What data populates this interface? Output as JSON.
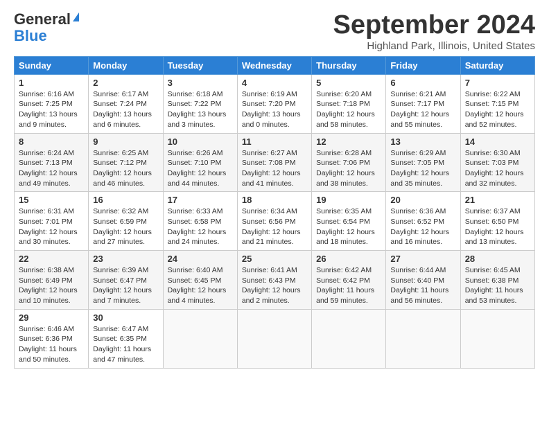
{
  "header": {
    "logo_general": "General",
    "logo_blue": "Blue",
    "month_title": "September 2024",
    "location": "Highland Park, Illinois, United States"
  },
  "weekdays": [
    "Sunday",
    "Monday",
    "Tuesday",
    "Wednesday",
    "Thursday",
    "Friday",
    "Saturday"
  ],
  "weeks": [
    [
      {
        "day": "1",
        "sunrise": "6:16 AM",
        "sunset": "7:25 PM",
        "daylight": "13 hours and 9 minutes."
      },
      {
        "day": "2",
        "sunrise": "6:17 AM",
        "sunset": "7:24 PM",
        "daylight": "13 hours and 6 minutes."
      },
      {
        "day": "3",
        "sunrise": "6:18 AM",
        "sunset": "7:22 PM",
        "daylight": "13 hours and 3 minutes."
      },
      {
        "day": "4",
        "sunrise": "6:19 AM",
        "sunset": "7:20 PM",
        "daylight": "13 hours and 0 minutes."
      },
      {
        "day": "5",
        "sunrise": "6:20 AM",
        "sunset": "7:18 PM",
        "daylight": "12 hours and 58 minutes."
      },
      {
        "day": "6",
        "sunrise": "6:21 AM",
        "sunset": "7:17 PM",
        "daylight": "12 hours and 55 minutes."
      },
      {
        "day": "7",
        "sunrise": "6:22 AM",
        "sunset": "7:15 PM",
        "daylight": "12 hours and 52 minutes."
      }
    ],
    [
      {
        "day": "8",
        "sunrise": "6:24 AM",
        "sunset": "7:13 PM",
        "daylight": "12 hours and 49 minutes."
      },
      {
        "day": "9",
        "sunrise": "6:25 AM",
        "sunset": "7:12 PM",
        "daylight": "12 hours and 46 minutes."
      },
      {
        "day": "10",
        "sunrise": "6:26 AM",
        "sunset": "7:10 PM",
        "daylight": "12 hours and 44 minutes."
      },
      {
        "day": "11",
        "sunrise": "6:27 AM",
        "sunset": "7:08 PM",
        "daylight": "12 hours and 41 minutes."
      },
      {
        "day": "12",
        "sunrise": "6:28 AM",
        "sunset": "7:06 PM",
        "daylight": "12 hours and 38 minutes."
      },
      {
        "day": "13",
        "sunrise": "6:29 AM",
        "sunset": "7:05 PM",
        "daylight": "12 hours and 35 minutes."
      },
      {
        "day": "14",
        "sunrise": "6:30 AM",
        "sunset": "7:03 PM",
        "daylight": "12 hours and 32 minutes."
      }
    ],
    [
      {
        "day": "15",
        "sunrise": "6:31 AM",
        "sunset": "7:01 PM",
        "daylight": "12 hours and 30 minutes."
      },
      {
        "day": "16",
        "sunrise": "6:32 AM",
        "sunset": "6:59 PM",
        "daylight": "12 hours and 27 minutes."
      },
      {
        "day": "17",
        "sunrise": "6:33 AM",
        "sunset": "6:58 PM",
        "daylight": "12 hours and 24 minutes."
      },
      {
        "day": "18",
        "sunrise": "6:34 AM",
        "sunset": "6:56 PM",
        "daylight": "12 hours and 21 minutes."
      },
      {
        "day": "19",
        "sunrise": "6:35 AM",
        "sunset": "6:54 PM",
        "daylight": "12 hours and 18 minutes."
      },
      {
        "day": "20",
        "sunrise": "6:36 AM",
        "sunset": "6:52 PM",
        "daylight": "12 hours and 16 minutes."
      },
      {
        "day": "21",
        "sunrise": "6:37 AM",
        "sunset": "6:50 PM",
        "daylight": "12 hours and 13 minutes."
      }
    ],
    [
      {
        "day": "22",
        "sunrise": "6:38 AM",
        "sunset": "6:49 PM",
        "daylight": "12 hours and 10 minutes."
      },
      {
        "day": "23",
        "sunrise": "6:39 AM",
        "sunset": "6:47 PM",
        "daylight": "12 hours and 7 minutes."
      },
      {
        "day": "24",
        "sunrise": "6:40 AM",
        "sunset": "6:45 PM",
        "daylight": "12 hours and 4 minutes."
      },
      {
        "day": "25",
        "sunrise": "6:41 AM",
        "sunset": "6:43 PM",
        "daylight": "12 hours and 2 minutes."
      },
      {
        "day": "26",
        "sunrise": "6:42 AM",
        "sunset": "6:42 PM",
        "daylight": "11 hours and 59 minutes."
      },
      {
        "day": "27",
        "sunrise": "6:44 AM",
        "sunset": "6:40 PM",
        "daylight": "11 hours and 56 minutes."
      },
      {
        "day": "28",
        "sunrise": "6:45 AM",
        "sunset": "6:38 PM",
        "daylight": "11 hours and 53 minutes."
      }
    ],
    [
      {
        "day": "29",
        "sunrise": "6:46 AM",
        "sunset": "6:36 PM",
        "daylight": "11 hours and 50 minutes."
      },
      {
        "day": "30",
        "sunrise": "6:47 AM",
        "sunset": "6:35 PM",
        "daylight": "11 hours and 47 minutes."
      },
      null,
      null,
      null,
      null,
      null
    ]
  ],
  "labels": {
    "sunrise_prefix": "Sunrise: ",
    "sunset_prefix": "Sunset: ",
    "daylight_prefix": "Daylight: "
  }
}
